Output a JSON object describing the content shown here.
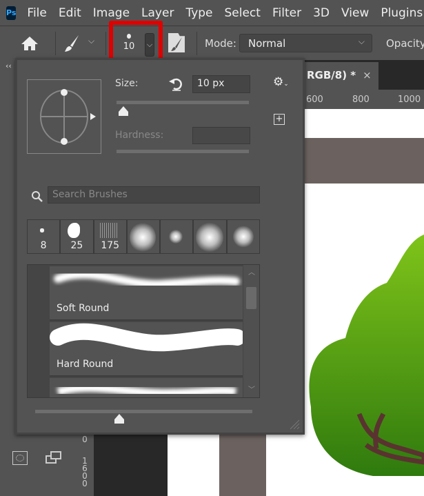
{
  "app": {
    "logo": "Ps",
    "menu": [
      "File",
      "Edit",
      "Image",
      "Layer",
      "Type",
      "Select",
      "Filter",
      "3D",
      "View",
      "Plugins"
    ]
  },
  "options": {
    "brush_size": "10",
    "mode_label": "Mode:",
    "mode_value": "Normal",
    "opacity_label": "Opacity:"
  },
  "document": {
    "tab_title": "RGB/8) *",
    "close": "×",
    "ruler_ticks": [
      "600",
      "800",
      "1000"
    ],
    "vruler_top": "0",
    "vruler_bottom": "1600"
  },
  "panel": {
    "size_label": "Size:",
    "size_value": "10 px",
    "hardness_label": "Hardness:",
    "search_placeholder": "Search Brushes",
    "presets": [
      {
        "size": "8"
      },
      {
        "size": "25"
      },
      {
        "size": "175"
      },
      {
        "size": ""
      },
      {
        "size": ""
      },
      {
        "size": ""
      },
      {
        "size": ""
      }
    ],
    "brushes": [
      {
        "name": "Soft Round"
      },
      {
        "name": "Hard Round"
      },
      {
        "name": ""
      }
    ]
  },
  "colors": {
    "highlight": "#e00000",
    "panel": "#535353",
    "canvas_brown": "#6b625f",
    "tree_green": "#4c9a12"
  }
}
